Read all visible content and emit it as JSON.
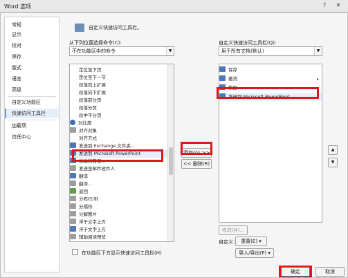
{
  "window": {
    "title": "Word 选项",
    "help_glyph": "?",
    "close_glyph": "✕"
  },
  "sidebar": {
    "items": [
      {
        "label": "常规"
      },
      {
        "label": "显示"
      },
      {
        "label": "校对"
      },
      {
        "label": "保存"
      },
      {
        "label": "版式"
      },
      {
        "label": "语言"
      },
      {
        "label": "高级"
      },
      {
        "label": "自定义功能区"
      },
      {
        "label": "快速访问工具栏",
        "selected": true
      },
      {
        "label": "加载项"
      },
      {
        "label": "信任中心"
      }
    ]
  },
  "header": {
    "text": "自定义快速访问工具栏。"
  },
  "left_panel": {
    "choose_label": "从下列位置选择命令(C):",
    "choose_value": "不在功能区中的命令",
    "commands": [
      {
        "label": "定位至下页",
        "icon": "none"
      },
      {
        "label": "定位至下一节",
        "icon": "none"
      },
      {
        "label": "段落向上扩展",
        "icon": "none"
      },
      {
        "label": "段落向下扩展",
        "icon": "none"
      },
      {
        "label": "段落前分页",
        "icon": "none"
      },
      {
        "label": "段落分页",
        "icon": "none"
      },
      {
        "label": "段中不分页",
        "icon": "none"
      },
      {
        "label": "对比度",
        "icon": "circle",
        "sub": "▸"
      },
      {
        "label": "对齐对象",
        "icon": "gray"
      },
      {
        "label": "对齐方式",
        "icon": "none",
        "sub": "▸"
      },
      {
        "label": "发送到 Exchange 文件夹...",
        "icon": "blue"
      },
      {
        "label": "发送到 Microsoft PowerPoint",
        "icon": "blue",
        "highlight": true
      },
      {
        "label": "发送所有者...",
        "icon": "blue"
      },
      {
        "label": "发送至邮件收件人",
        "icon": "gray"
      },
      {
        "label": "翻译",
        "icon": "blue"
      },
      {
        "label": "翻译...",
        "icon": "gray"
      },
      {
        "label": "返回",
        "icon": "green"
      },
      {
        "label": "分布行/列",
        "icon": "gray"
      },
      {
        "label": "分隔符",
        "icon": "gray"
      },
      {
        "label": "分解图片",
        "icon": "gray"
      },
      {
        "label": "浮于文字上方",
        "icon": "gray"
      },
      {
        "label": "浮于文字上方",
        "icon": "blue"
      },
      {
        "label": "辅助阅读预览",
        "icon": "gray"
      }
    ],
    "show_below_label": "在功能区下方显示快速访问工具栏(H)"
  },
  "middle": {
    "add_label": "添加(A) >>",
    "remove_label": "<< 删除(R)"
  },
  "right_panel": {
    "customize_label": "自定义快速访问工具栏(Q):",
    "customize_value": "用于所有文档(默认)",
    "items": [
      {
        "label": "保存",
        "icon": "blue"
      },
      {
        "label": "撤消",
        "icon": "blue",
        "sub": "▸"
      },
      {
        "label": "恢复",
        "icon": "blue"
      },
      {
        "label": "发送到 Microsoft PowerPoint",
        "icon": "blue",
        "highlight": true
      }
    ],
    "modify_label": "修改(M)...",
    "customize_row_label": "自定义:",
    "reset_label": "重置(E) ▾",
    "import_export_label": "导入/导出(P) ▾",
    "up_glyph": "▲",
    "down_glyph": "▼"
  },
  "footer": {
    "ok_label": "确定",
    "cancel_label": "取消"
  }
}
